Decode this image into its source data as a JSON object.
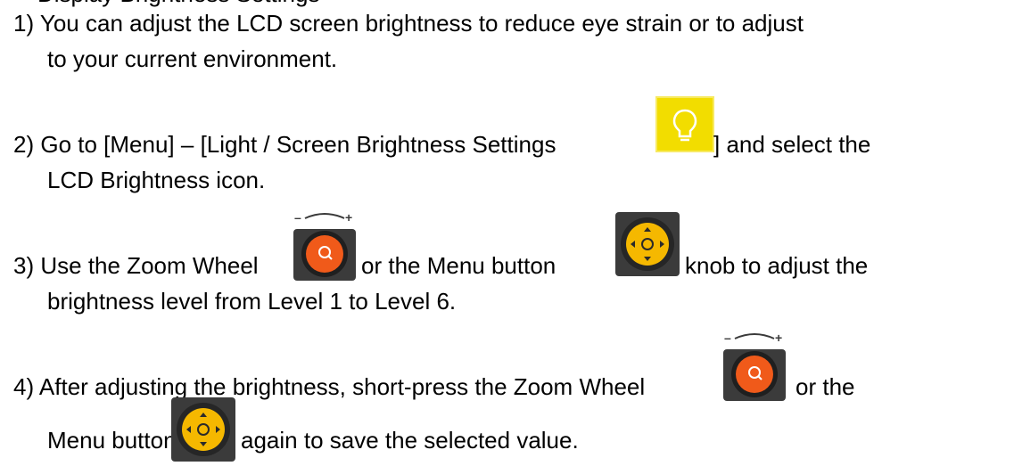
{
  "doc": {
    "top_cut_text": "Display Brightness Settings",
    "step1": {
      "num": "1)",
      "line1": " You can adjust the LCD screen brightness to reduce eye strain or to adjust",
      "line2": "to your current environment."
    },
    "step2": {
      "num": "2)",
      "line1_a": "Go to [Menu] – [Light / Screen Brightness Settings",
      "line1_b": "] and select the",
      "line2": "LCD Brightness icon."
    },
    "step3": {
      "num": "3)",
      "line1_a": "Use the Zoom Wheel",
      "line1_b": "or the Menu button",
      "line1_c": "knob to adjust the",
      "line2": "brightness level from Level 1 to Level 6."
    },
    "step4": {
      "num": "4)",
      "line1_a": "After adjusting the brightness, short-press the Zoom Wheel",
      "line1_b": "or the",
      "line2_a": "Menu button",
      "line2_b": "again to save the selected value."
    }
  },
  "icons": {
    "bulb": "lightbulb-icon",
    "wheel": "zoom-wheel-icon",
    "knob": "menu-button-icon",
    "colors": {
      "bulb_bg": "#f2dd00",
      "wheel_orange": "#f05a1a",
      "knob_yellow": "#f5b800",
      "dark": "#2a2a2a"
    }
  }
}
